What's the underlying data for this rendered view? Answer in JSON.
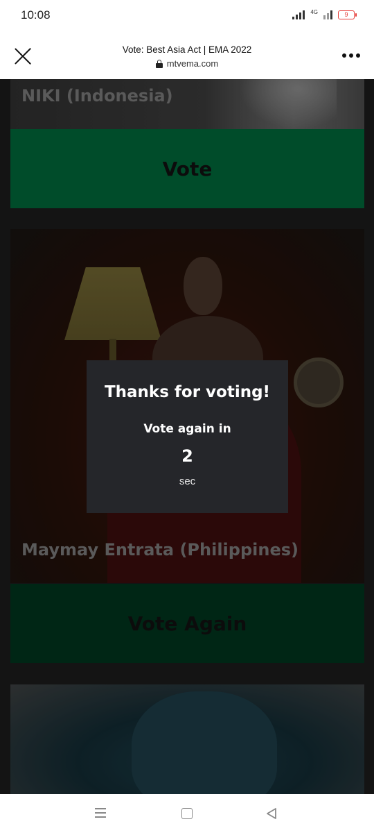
{
  "status_bar": {
    "time": "10:08",
    "network": "4G",
    "battery": "9"
  },
  "browser": {
    "title": "Vote: Best Asia Act | EMA 2022",
    "url": "mtvema.com"
  },
  "cards": [
    {
      "artist": "NIKI (Indonesia)",
      "button_label": "Vote"
    },
    {
      "artist": "Maymay Entrata (Philippines)",
      "button_label": "Vote Again"
    }
  ],
  "modal": {
    "title": "Thanks for voting!",
    "subtitle": "Vote again in",
    "countdown": "2",
    "unit": "sec"
  },
  "colors": {
    "vote_green": "#006638",
    "vote_again_green": "#00331c",
    "modal_bg": "#25262a"
  }
}
